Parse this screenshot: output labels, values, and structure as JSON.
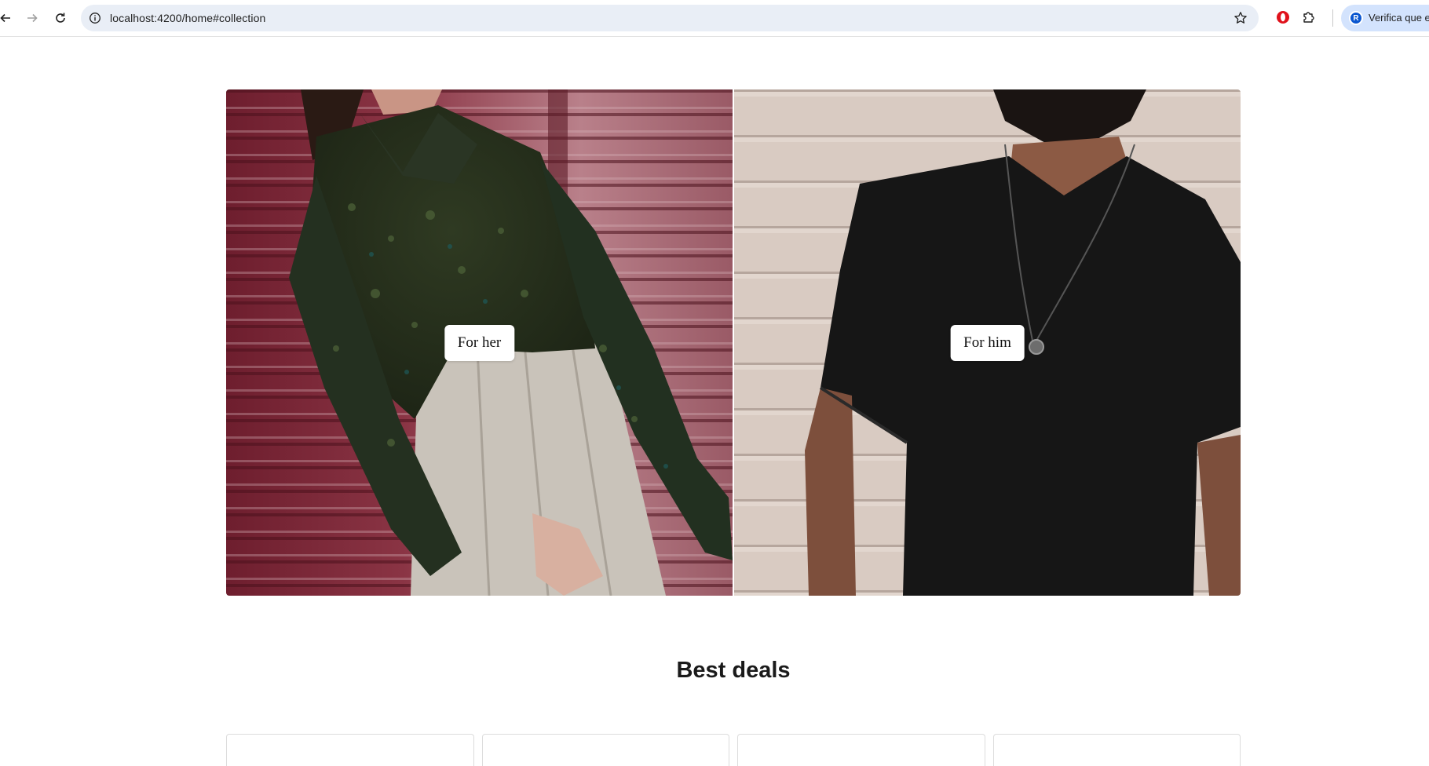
{
  "browser": {
    "url": "localhost:4200/home#collection",
    "profile_avatar_letter": "R",
    "profile_chip_text": "Verifica que er"
  },
  "collection": {
    "cards": [
      {
        "label": "For her",
        "image": "woman-paisley-shirt-photo"
      },
      {
        "label": "For him",
        "image": "man-black-tshirt-photo"
      }
    ]
  },
  "best_deals": {
    "title": "Best deals",
    "cards_visible": 4
  },
  "colors": {
    "omnibox_bg": "#e9eef6",
    "profile_chip_bg": "#d3e3fd",
    "page_bg": "#ffffff"
  }
}
